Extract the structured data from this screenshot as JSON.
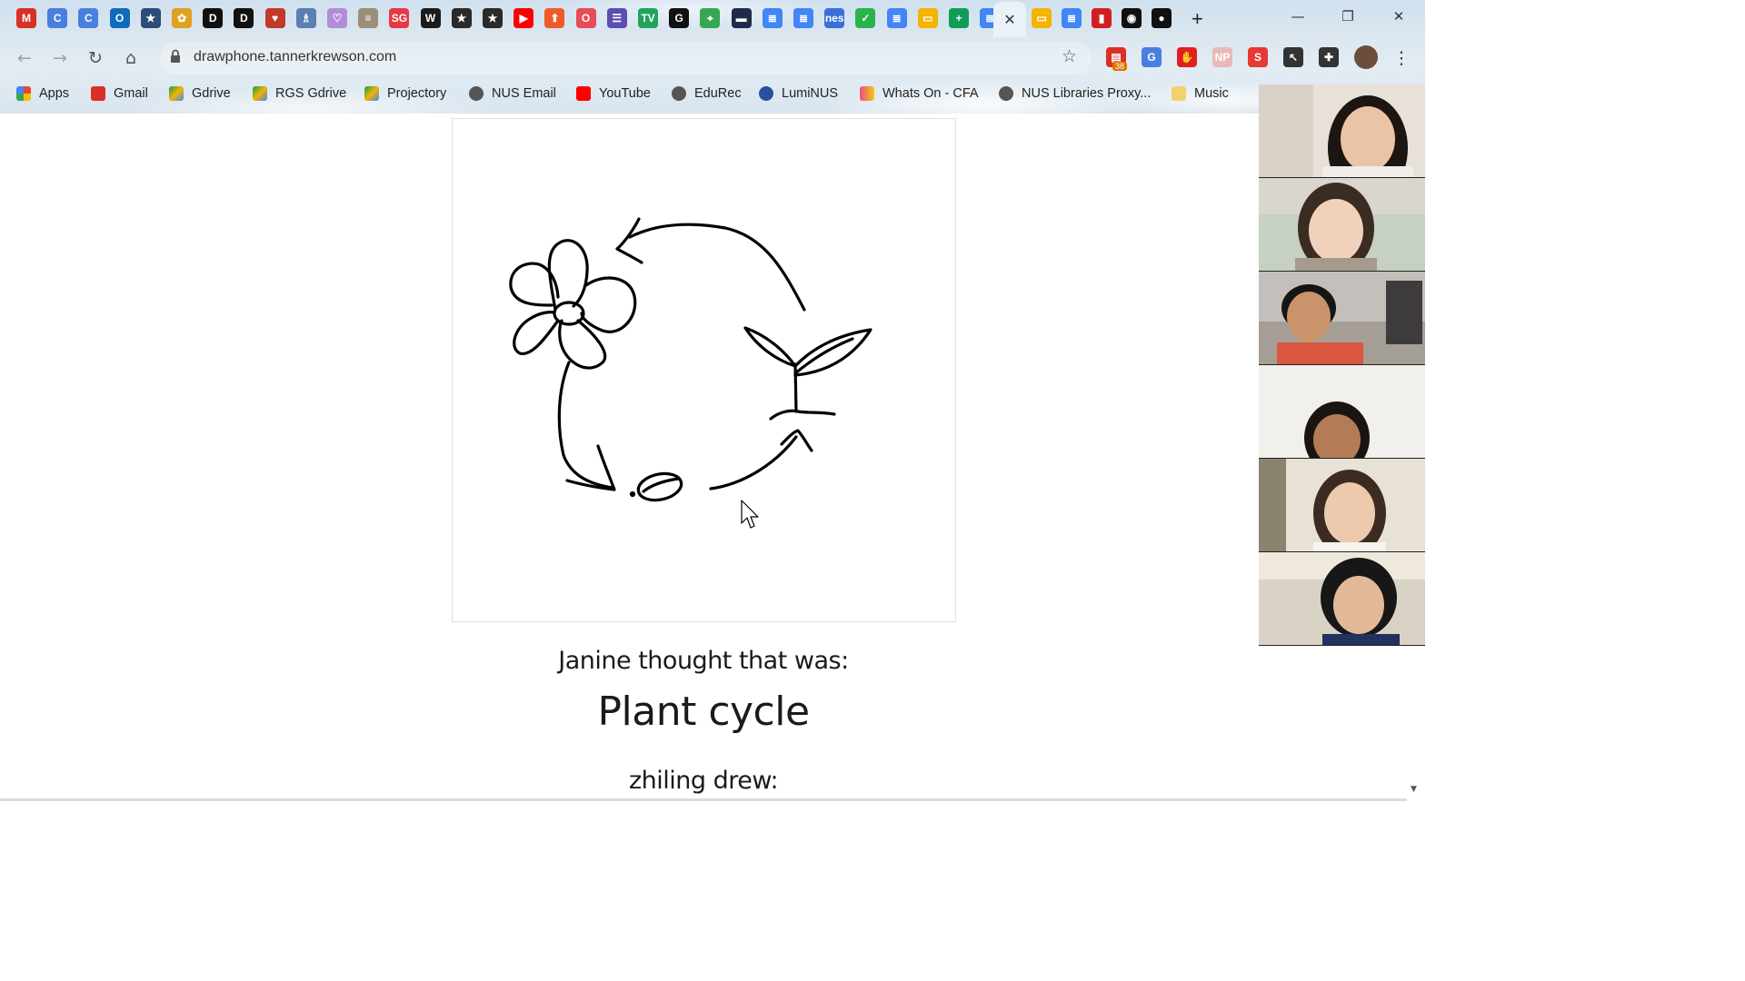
{
  "browser": {
    "tabs": [
      {
        "icon": "gmail-icon",
        "color": "#d93025",
        "text": "M"
      },
      {
        "icon": "c-circle-icon",
        "color": "#4a7fe0",
        "text": "C"
      },
      {
        "icon": "c-circle-icon",
        "color": "#4a7fe0",
        "text": "C"
      },
      {
        "icon": "outlook-icon",
        "color": "#0f6cbd",
        "text": "O"
      },
      {
        "icon": "star-icon",
        "color": "#2b4d7a",
        "text": "★"
      },
      {
        "icon": "sunflower-icon",
        "color": "#e0a020",
        "text": "✿"
      },
      {
        "icon": "d-icon",
        "color": "#111111",
        "text": "D"
      },
      {
        "icon": "d-icon",
        "color": "#111111",
        "text": "D"
      },
      {
        "icon": "shield-icon",
        "color": "#c0392b",
        "text": "♥"
      },
      {
        "icon": "library-icon",
        "color": "#5b7fb0",
        "text": "♗"
      },
      {
        "icon": "heart-doc-icon",
        "color": "#b38cd9",
        "text": "♡"
      },
      {
        "icon": "paper-icon",
        "color": "#9a8f7a",
        "text": "≡"
      },
      {
        "icon": "sg-icon",
        "color": "#e53945",
        "text": "SG"
      },
      {
        "icon": "wri-icon",
        "color": "#1b1b1b",
        "text": "W"
      },
      {
        "icon": "orange-star-icon",
        "color": "#2a2a2a",
        "text": "★"
      },
      {
        "icon": "orange-star-icon",
        "color": "#2a2a2a",
        "text": "★"
      },
      {
        "icon": "youtube-icon",
        "color": "#ff0000",
        "text": "▶"
      },
      {
        "icon": "up-arrow-icon",
        "color": "#f05a28",
        "text": "⬆"
      },
      {
        "icon": "opera-icon",
        "color": "#e84c5a",
        "text": "O"
      },
      {
        "icon": "list-icon",
        "color": "#5c4db1",
        "text": "☰"
      },
      {
        "icon": "tv-icon",
        "color": "#1fa45a",
        "text": "TV"
      },
      {
        "icon": "grammarly-icon",
        "color": "#111111",
        "text": "G"
      },
      {
        "icon": "maps-icon",
        "color": "#34a853",
        "text": "⌖"
      },
      {
        "icon": "dark-tab-icon",
        "color": "#1e2b4a",
        "text": "▬"
      },
      {
        "icon": "docs-icon",
        "color": "#4285f4",
        "text": "≣"
      },
      {
        "icon": "docs-icon",
        "color": "#4285f4",
        "text": "≣"
      },
      {
        "icon": "nes-icon",
        "color": "#3a6fd8",
        "text": "nes"
      },
      {
        "icon": "green-leaf-icon",
        "color": "#2bb24c",
        "text": "✓"
      },
      {
        "icon": "docs-icon",
        "color": "#4285f4",
        "text": "≣"
      },
      {
        "icon": "slides-icon",
        "color": "#f4b400",
        "text": "▭"
      },
      {
        "icon": "sheets-icon",
        "color": "#0f9d58",
        "text": "+"
      },
      {
        "icon": "docs-icon",
        "color": "#4285f4",
        "text": "≣"
      }
    ],
    "after_tabs": [
      {
        "icon": "slides-icon",
        "color": "#f4b400",
        "text": "▭"
      },
      {
        "icon": "docs-icon",
        "color": "#4285f4",
        "text": "≣"
      },
      {
        "icon": "red-bars-icon",
        "color": "#d11f1f",
        "text": "▮"
      },
      {
        "icon": "dark-image-icon",
        "color": "#111111",
        "text": "◉"
      },
      {
        "icon": "github-icon",
        "color": "#111111",
        "text": "●"
      }
    ],
    "active_tab_close": "✕",
    "new_tab": "+",
    "window_controls": {
      "minimize": "—",
      "restore": "❐",
      "close": "✕"
    },
    "url": "drawphone.tannerkrewson.com",
    "extensions": [
      {
        "icon": "calendar-badge-icon",
        "color": "#d93025",
        "text": "▤",
        "badge": "38"
      },
      {
        "icon": "translate-icon",
        "color": "#4a7fe0",
        "text": "G"
      },
      {
        "icon": "hand-block-icon",
        "color": "#e02020",
        "text": "✋"
      },
      {
        "icon": "np-icon",
        "color": "#e9b9b9",
        "text": "NP"
      },
      {
        "icon": "s-icon",
        "color": "#e53935",
        "text": "S"
      },
      {
        "icon": "cursor-ext-icon",
        "color": "#333333",
        "text": "↖"
      },
      {
        "icon": "puzzle-icon",
        "color": "#333333",
        "text": "✚"
      }
    ],
    "bookmarks": [
      {
        "label": "Apps",
        "icon": "apps-icon"
      },
      {
        "label": "Gmail",
        "icon": "gmail-icon"
      },
      {
        "label": "Gdrive",
        "icon": "drive-icon"
      },
      {
        "label": "RGS Gdrive",
        "icon": "drive-icon"
      },
      {
        "label": "Projectory",
        "icon": "drive-icon"
      },
      {
        "label": "NUS Email",
        "icon": "globe-icon"
      },
      {
        "label": "YouTube",
        "icon": "youtube-icon"
      },
      {
        "label": "EduRec",
        "icon": "globe-icon"
      },
      {
        "label": "LumiNUS",
        "icon": "luminus-icon"
      },
      {
        "label": "Whats On - CFA",
        "icon": "cfa-icon"
      },
      {
        "label": "NUS Libraries Proxy...",
        "icon": "globe-icon"
      },
      {
        "label": "Music",
        "icon": "folder-icon"
      }
    ]
  },
  "game": {
    "guess_label": "Janine thought that was:",
    "guess": "Plant cycle",
    "next_label": "zhiling drew:"
  },
  "colors": {
    "ink": "#000000",
    "caption": "#1a1a1a"
  }
}
